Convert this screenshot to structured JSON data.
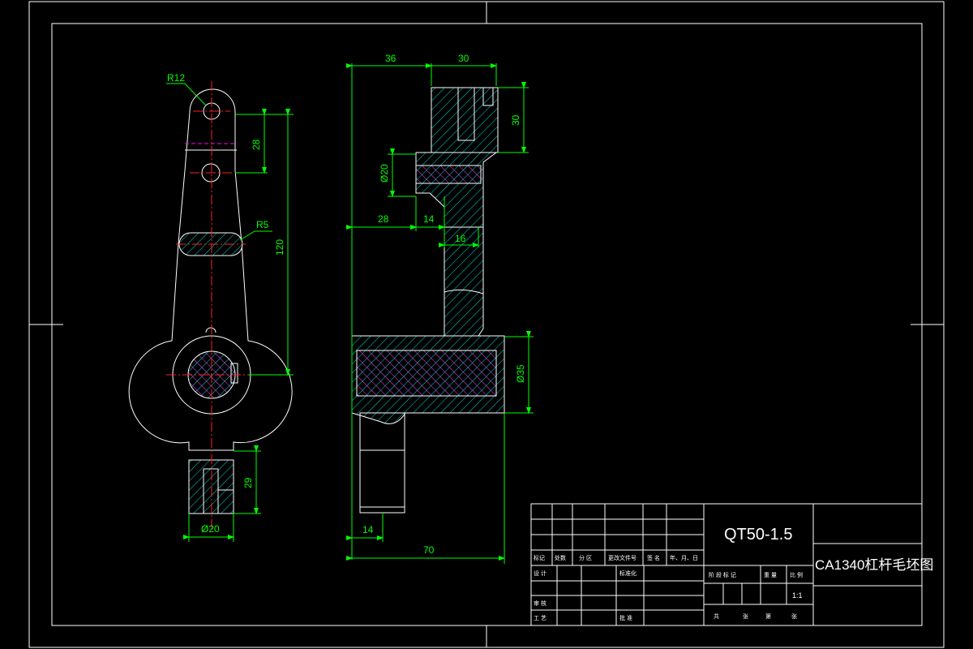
{
  "drawing": {
    "part_material": "QT50-1.5",
    "part_name": "CA1340杠杆毛坯图",
    "scale": "1:1"
  },
  "dimensions": {
    "front": {
      "r12": "R12",
      "r5": "R5",
      "d28": "28",
      "d120": "120",
      "d29": "29",
      "dia20": "Ø20"
    },
    "side": {
      "d36": "36",
      "d30_top": "30",
      "d30_right": "30",
      "dia20": "Ø20",
      "d28": "28",
      "d14_mid": "14",
      "d16": "16",
      "dia35": "Ø35",
      "d14_bot": "14",
      "d70": "70"
    }
  },
  "title_block": {
    "row1": [
      "标记",
      "处数",
      "分 区",
      "更改文件号",
      "签 名",
      "年、月、日"
    ],
    "design_label": "设 计",
    "standard_label": "标准化",
    "review_label": "审 核",
    "process_label": "工 艺",
    "approve_label": "批 准",
    "stage_label": "阶 段 标 记",
    "weight_label": "重 量",
    "scale_label": "比 例",
    "sheet_row": [
      "共",
      "张",
      "第",
      "张"
    ]
  },
  "colors": {
    "background": "#000000",
    "outline": "#ffffff",
    "dimension": "#00ff00",
    "centerline": "#ff2020",
    "hidden": "#ff00ff",
    "hatch": "#00e0e0"
  }
}
